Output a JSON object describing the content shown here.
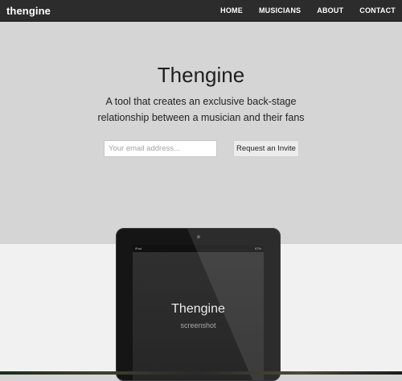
{
  "navbar": {
    "brand": "thengine",
    "links": [
      {
        "label": "HOME"
      },
      {
        "label": "MUSICIANS"
      },
      {
        "label": "ABOUT"
      },
      {
        "label": "CONTACT"
      }
    ]
  },
  "hero": {
    "title": "Thengine",
    "subtitle_line1": "A tool that creates an exclusive back-stage",
    "subtitle_line2": "relationship between a musician and their fans",
    "email_placeholder": "Your email address...",
    "email_value": "",
    "invite_label": "Request an Invite"
  },
  "device": {
    "status_left": "iPad",
    "status_right": "97%",
    "screen_title": "Thengine",
    "screen_subtitle": "screenshot"
  },
  "colors": {
    "navbar_bg": "#2c2c2c",
    "hero_bg": "#d5d5d5",
    "bottom_bg": "#f1f1f1",
    "device_frame": "#151515"
  }
}
